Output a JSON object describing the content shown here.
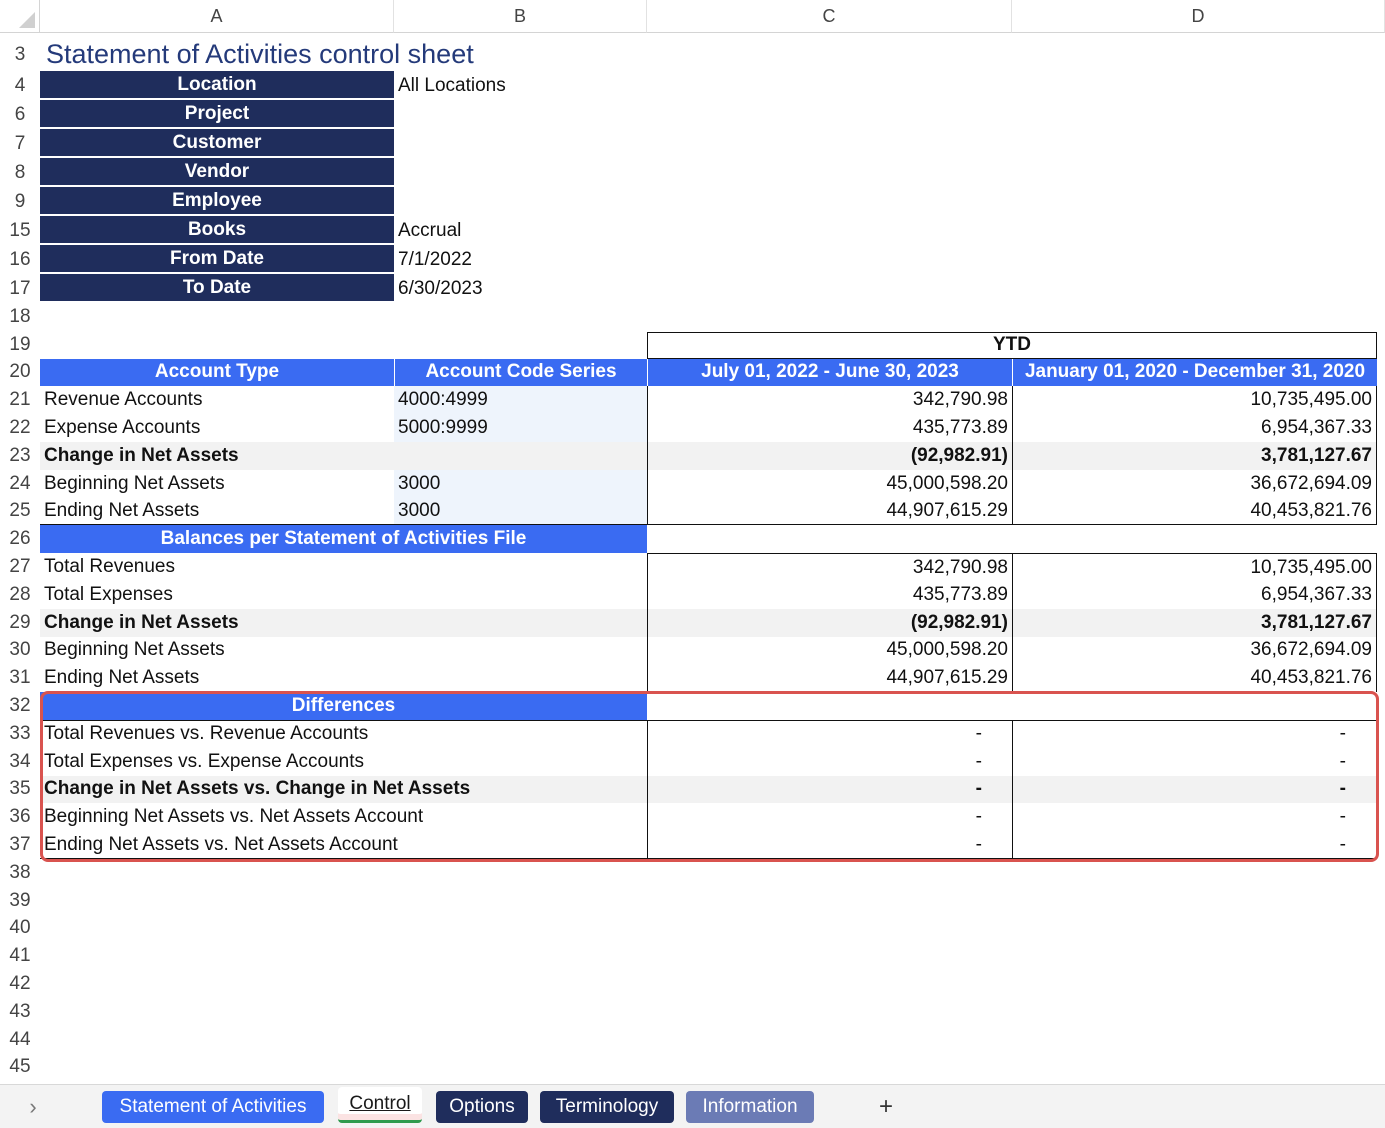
{
  "columns": [
    "A",
    "B",
    "C",
    "D"
  ],
  "title": "Statement of Activities control sheet",
  "params": [
    {
      "row": "4",
      "label": "Location",
      "value": "All Locations"
    },
    {
      "row": "6",
      "label": "Project",
      "value": ""
    },
    {
      "row": "7",
      "label": "Customer",
      "value": ""
    },
    {
      "row": "8",
      "label": "Vendor",
      "value": ""
    },
    {
      "row": "9",
      "label": "Employee",
      "value": ""
    },
    {
      "row": "15",
      "label": "Books",
      "value": "Accrual"
    },
    {
      "row": "16",
      "label": "From Date",
      "value": "7/1/2022"
    },
    {
      "row": "17",
      "label": "To Date",
      "value": "6/30/2023"
    }
  ],
  "ytd_label": "YTD",
  "table_headers": [
    "Account Type",
    "Account Code Series",
    "July 01, 2022 - June 30, 2023",
    "January 01, 2020 - December 31, 2020"
  ],
  "accounts": [
    {
      "label": "Revenue Accounts",
      "code": "4000:4999",
      "c": "342,790.98",
      "d": "10,735,495.00",
      "bold": false
    },
    {
      "label": "Expense Accounts",
      "code": "5000:9999",
      "c": "435,773.89",
      "d": "6,954,367.33",
      "bold": false
    },
    {
      "label": "Change in Net Assets",
      "code": "",
      "c": "(92,982.91)",
      "d": "3,781,127.67",
      "bold": true
    },
    {
      "label": "Beginning Net Assets",
      "code": "3000",
      "c": "45,000,598.20",
      "d": "36,672,694.09",
      "bold": false
    },
    {
      "label": "Ending Net Assets",
      "code": "3000",
      "c": "44,907,615.29",
      "d": "40,453,821.76",
      "bold": false
    }
  ],
  "balances_header": "Balances per Statement of Activities File",
  "balances": [
    {
      "label": "Total Revenues",
      "c": "342,790.98",
      "d": "10,735,495.00",
      "bold": false
    },
    {
      "label": "Total Expenses",
      "c": "435,773.89",
      "d": "6,954,367.33",
      "bold": false
    },
    {
      "label": "Change in Net Assets",
      "c": "(92,982.91)",
      "d": "3,781,127.67",
      "bold": true
    },
    {
      "label": "Beginning Net Assets",
      "c": "45,000,598.20",
      "d": "36,672,694.09",
      "bold": false
    },
    {
      "label": "Ending Net Assets",
      "c": "44,907,615.29",
      "d": "40,453,821.76",
      "bold": false
    }
  ],
  "differences_header": "Differences",
  "differences": [
    {
      "label": "Total Revenues vs. Revenue Accounts",
      "c": "-",
      "d": "-",
      "bold": false
    },
    {
      "label": "Total Expenses vs. Expense Accounts",
      "c": "-",
      "d": "-",
      "bold": false
    },
    {
      "label": "Change in Net Assets vs. Change in Net Assets",
      "c": "-",
      "d": "-",
      "bold": true
    },
    {
      "label": "Beginning Net Assets vs. Net Assets Account",
      "c": "-",
      "d": "-",
      "bold": false
    },
    {
      "label": "Ending Net Assets vs. Net Assets Account",
      "c": "-",
      "d": "-",
      "bold": false
    }
  ],
  "row_numbers": [
    "3",
    "4",
    "6",
    "7",
    "8",
    "9",
    "15",
    "16",
    "17",
    "18",
    "19",
    "20",
    "21",
    "22",
    "23",
    "24",
    "25",
    "26",
    "27",
    "28",
    "29",
    "30",
    "31",
    "32",
    "33",
    "34",
    "35",
    "36",
    "37",
    "38",
    "39",
    "40",
    "41",
    "42",
    "43",
    "44",
    "45"
  ],
  "tabs": {
    "nav_arrow": "›",
    "items": [
      {
        "label": "Statement of Activities",
        "bg": "#3a6bf2",
        "fg": "#ffffff",
        "active": false
      },
      {
        "label": "Control",
        "bg": "#fbe3e3",
        "fg": "#1a1a1a",
        "active": true
      },
      {
        "label": "Options",
        "bg": "#1f2d5c",
        "fg": "#ffffff",
        "active": false
      },
      {
        "label": "Terminology",
        "bg": "#1f2d5c",
        "fg": "#ffffff",
        "active": false
      },
      {
        "label": "Information",
        "bg": "#6b7bb5",
        "fg": "#ffffff",
        "active": false
      }
    ],
    "add_label": "+",
    "active_underline": "#2e9b4e"
  },
  "colors": {
    "navy": "#1f2d5c",
    "blue": "#3a6bf2",
    "highlight": "#d9534f"
  }
}
